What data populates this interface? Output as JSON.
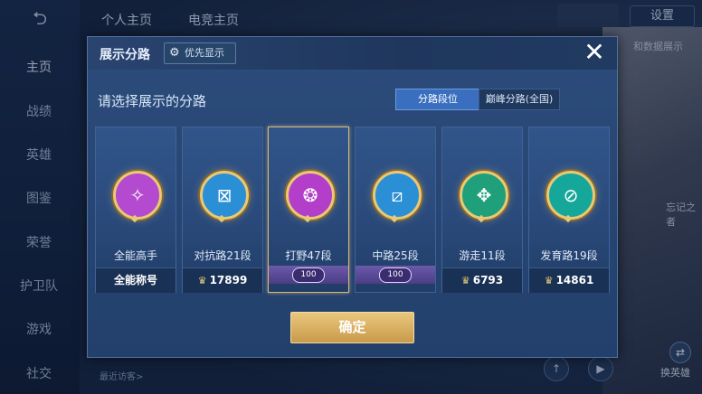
{
  "background": {
    "top_tabs": [
      "个人主页",
      "电竞主页"
    ],
    "settings": "设置",
    "side_nav": [
      "主页",
      "战绩",
      "英雄",
      "图鉴",
      "荣誉",
      "护卫队",
      "游戏",
      "社交"
    ],
    "right_label": "和数据展示",
    "right_label2": "忘记之者",
    "swap_hero": "换英雄",
    "visitor": "最近访客>"
  },
  "modal": {
    "title": "展示分路",
    "priority_label": "优先显示",
    "prompt": "请选择展示的分路",
    "segments": [
      "分路段位",
      "巅峰分路(全国)"
    ],
    "confirm": "确定"
  },
  "cards": [
    {
      "name": "全能高手",
      "score": "全能称号",
      "color": "#b44ad0",
      "glyph": "✧",
      "mode": "plain"
    },
    {
      "name": "对抗路21段",
      "score": "17899",
      "color": "#2b8fd6",
      "glyph": "⊠",
      "mode": "score"
    },
    {
      "name": "打野47段",
      "score": "100",
      "color": "#b23ec9",
      "glyph": "❂",
      "mode": "level"
    },
    {
      "name": "中路25段",
      "score": "100",
      "color": "#2b8fd6",
      "glyph": "⧄",
      "mode": "level"
    },
    {
      "name": "游走11段",
      "score": "6793",
      "color": "#1fa07a",
      "glyph": "✥",
      "mode": "score"
    },
    {
      "name": "发育路19段",
      "score": "14861",
      "color": "#15a89a",
      "glyph": "⊘",
      "mode": "score"
    }
  ]
}
